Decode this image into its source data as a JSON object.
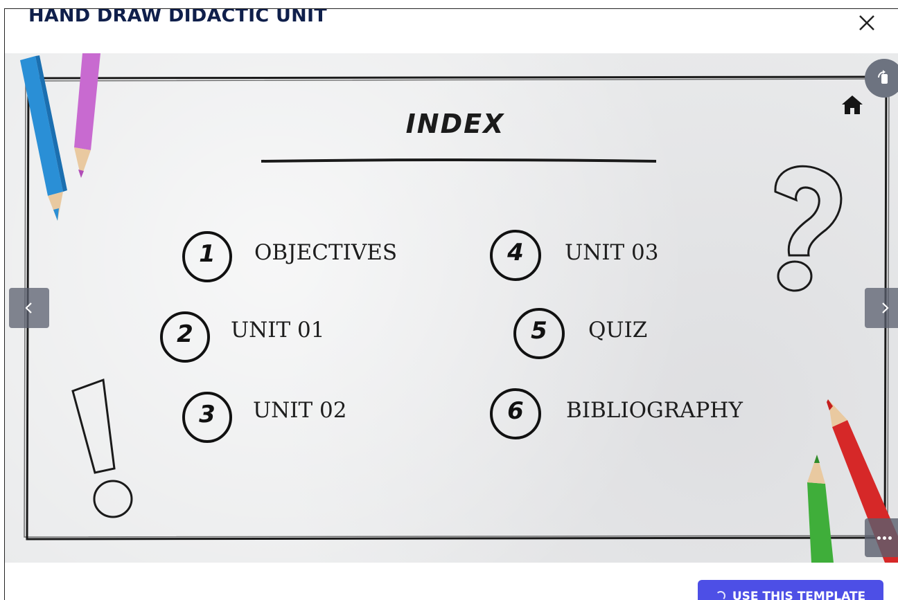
{
  "modal": {
    "title": "HAND DRAW DIDACTIC UNIT",
    "close_icon": "close-icon"
  },
  "slide": {
    "title": "INDEX",
    "items": [
      {
        "number": "1",
        "label": "OBJECTIVES"
      },
      {
        "number": "2",
        "label": "UNIT 01"
      },
      {
        "number": "3",
        "label": "UNIT 02"
      },
      {
        "number": "4",
        "label": "UNIT 03"
      },
      {
        "number": "5",
        "label": "QUIZ"
      },
      {
        "number": "6",
        "label": "BIBLIOGRAPHY"
      }
    ],
    "decorations": [
      "question-mark",
      "exclamation-mark",
      "pencils"
    ],
    "home_icon": "home-icon"
  },
  "viewer": {
    "prev_icon": "chevron-left-icon",
    "next_icon": "chevron-right-icon",
    "rotate_icon": "rotate-device-icon",
    "more_icon": "more-dots-icon"
  },
  "footer": {
    "use_template_label": "USE THIS TEMPLATE"
  },
  "colors": {
    "title": "#0f1f4b",
    "accent_button": "#4d4fe6",
    "slide_background": "#eaebec"
  }
}
